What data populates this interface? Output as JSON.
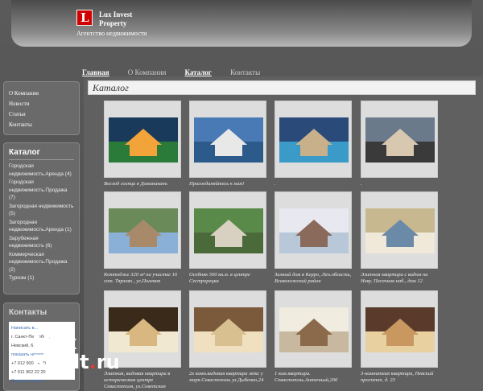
{
  "header": {
    "logo_letter": "L",
    "brand_line1": "Lux Invest",
    "brand_line2": "Property",
    "tagline": "Агентство недвижимости"
  },
  "nav": [
    "Главная",
    "О Компании",
    "Каталог",
    "Контакты"
  ],
  "sidebar_links": [
    "О Компании",
    "Новости",
    "Статьи",
    "Контакты"
  ],
  "catalog_box": {
    "title": "Каталог",
    "items": [
      "Городская недвижимость.Аренда (4)",
      "Городская недвижимость.Продажа (7)",
      "Загородная недвижимость (5)",
      "Загородная недвижимость.Аренда (1)",
      "Зарубежная недвижимость (6)",
      "Коммерческая недвижимость.Продажа (2)",
      "Туризм (1)"
    ]
  },
  "contacts": {
    "title": "Контакты",
    "line1": "Написать в...",
    "line2": "г. Санкт-Петербург,",
    "line3": "Невский, 6...",
    "line4": "показать номер",
    "phone1": "+7 912 900 94 00",
    "phone2": "+7 911 962 22 20",
    "callback": "Заказать звонок"
  },
  "main": {
    "title": "Каталог",
    "cards": [
      {
        "caption": "Восход солнца в Доминикане.",
        "icon": "sunrise-photo"
      },
      {
        "caption": "Присоединяйтесь к нам!",
        "icon": "jet-photo"
      },
      {
        "caption": ".",
        "icon": "villa-pool-photo"
      },
      {
        "caption": ".",
        "icon": "mansion-photo"
      },
      {
        "caption": "Коттедже 320 м² на участке 16 сот. Тярлево , ул.Полевая",
        "icon": "cottage-photo"
      },
      {
        "caption": "Особняк 500 кв.м. в центре Сестрорецка",
        "icon": "house-photo"
      },
      {
        "caption": "Зимний дом в Керро, Лен.область, Всеволожский район",
        "icon": "winter-house-photo"
      },
      {
        "caption": "Элитная квартира с видом на Неву. Песочная наб., дом 12",
        "icon": "interior-photo"
      },
      {
        "caption": "Элитная, видовая квартира в историческом центре Севастополя, ул.Советская",
        "icon": "living-room-photo"
      },
      {
        "caption": "2х комн.видовая квартира люкс у моря.Севастополь ул.Дыбенко,24",
        "icon": "apartment-photo"
      },
      {
        "caption": "1 ком.квартира. Севастополь.Античный,206",
        "icon": "room-photo"
      },
      {
        "caption": "3-комнатная квартира, Невский проспект, д. 23",
        "icon": "hall-photo"
      }
    ]
  },
  "watermark": {
    "line1": "Max",
    "line2a": "Realt",
    "line2b": ".",
    "line2c": "ru"
  },
  "colors": {
    "logo_red": "#d10000",
    "link_blue": "#3a6db5"
  }
}
